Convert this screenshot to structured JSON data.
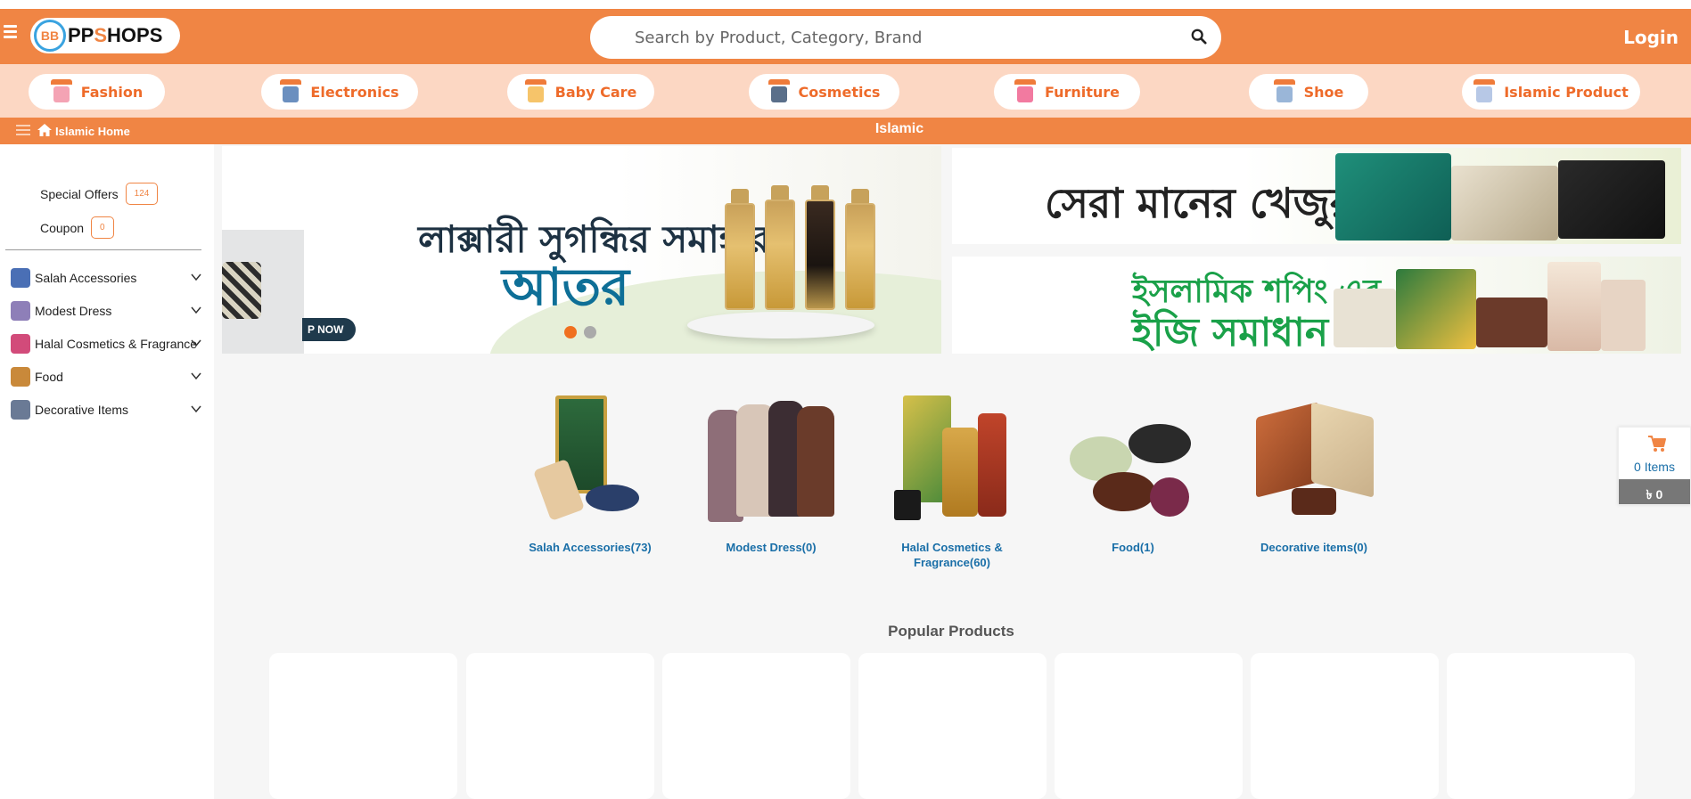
{
  "header": {
    "logo_text_a": "PP",
    "logo_text_b": "S",
    "logo_text_c": "HOPS",
    "logo_mark": "BB",
    "search_placeholder": "Search by Product, Category, Brand",
    "login_label": "Login"
  },
  "categories": [
    {
      "label": "Fashion",
      "color": "#f4a3b4"
    },
    {
      "label": "Electronics",
      "color": "#6b8fbf"
    },
    {
      "label": "Baby Care",
      "color": "#f6c46a"
    },
    {
      "label": "Cosmetics",
      "color": "#5a6f8a"
    },
    {
      "label": "Furniture",
      "color": "#f27aa0"
    },
    {
      "label": "Shoe",
      "color": "#9ab6d8"
    },
    {
      "label": "Islamic Product",
      "color": "#b7c8e6"
    }
  ],
  "breadcrumb": {
    "home_label": "Islamic Home",
    "title": "Islamic"
  },
  "sidebar": {
    "special_offers_label": "Special Offers",
    "special_offers_count": "124",
    "coupon_label": "Coupon",
    "coupon_count": "0",
    "items": [
      {
        "label": "Salah Accessories",
        "icon": "prayer-mat-icon",
        "color": "#4a6fb5"
      },
      {
        "label": "Modest Dress",
        "icon": "dress-icon",
        "color": "#8e7fb8"
      },
      {
        "label": "Halal Cosmetics & Fragrance",
        "icon": "perfume-icon",
        "color": "#d24b7a"
      },
      {
        "label": "Food",
        "icon": "food-icon",
        "color": "#c9893a"
      },
      {
        "label": "Decorative Items",
        "icon": "decor-icon",
        "color": "#6a7a95"
      }
    ]
  },
  "banners": {
    "main_line1": "লাক্সারী সুগন্ধির সমাহার",
    "main_line2": "আতর",
    "shop_now": "P NOW",
    "right1_text": "সেরা মানের খেজুর",
    "right2_line1": "ইসলামিক শপিং এর",
    "right2_line2": "ইজি সমাধান"
  },
  "category_grid": [
    {
      "label": "Salah Accessories(73)"
    },
    {
      "label": "Modest Dress(0)"
    },
    {
      "label": "Halal Cosmetics & Fragrance(60)"
    },
    {
      "label": "Food(1)"
    },
    {
      "label": "Decorative items(0)"
    }
  ],
  "popular": {
    "title": "Popular Products"
  },
  "cart": {
    "items_label": "0 Items",
    "total": "৳ 0"
  },
  "colors": {
    "brand_orange": "#f08544",
    "category_bar": "#fcd7c3",
    "link_blue": "#1a6fa8"
  }
}
